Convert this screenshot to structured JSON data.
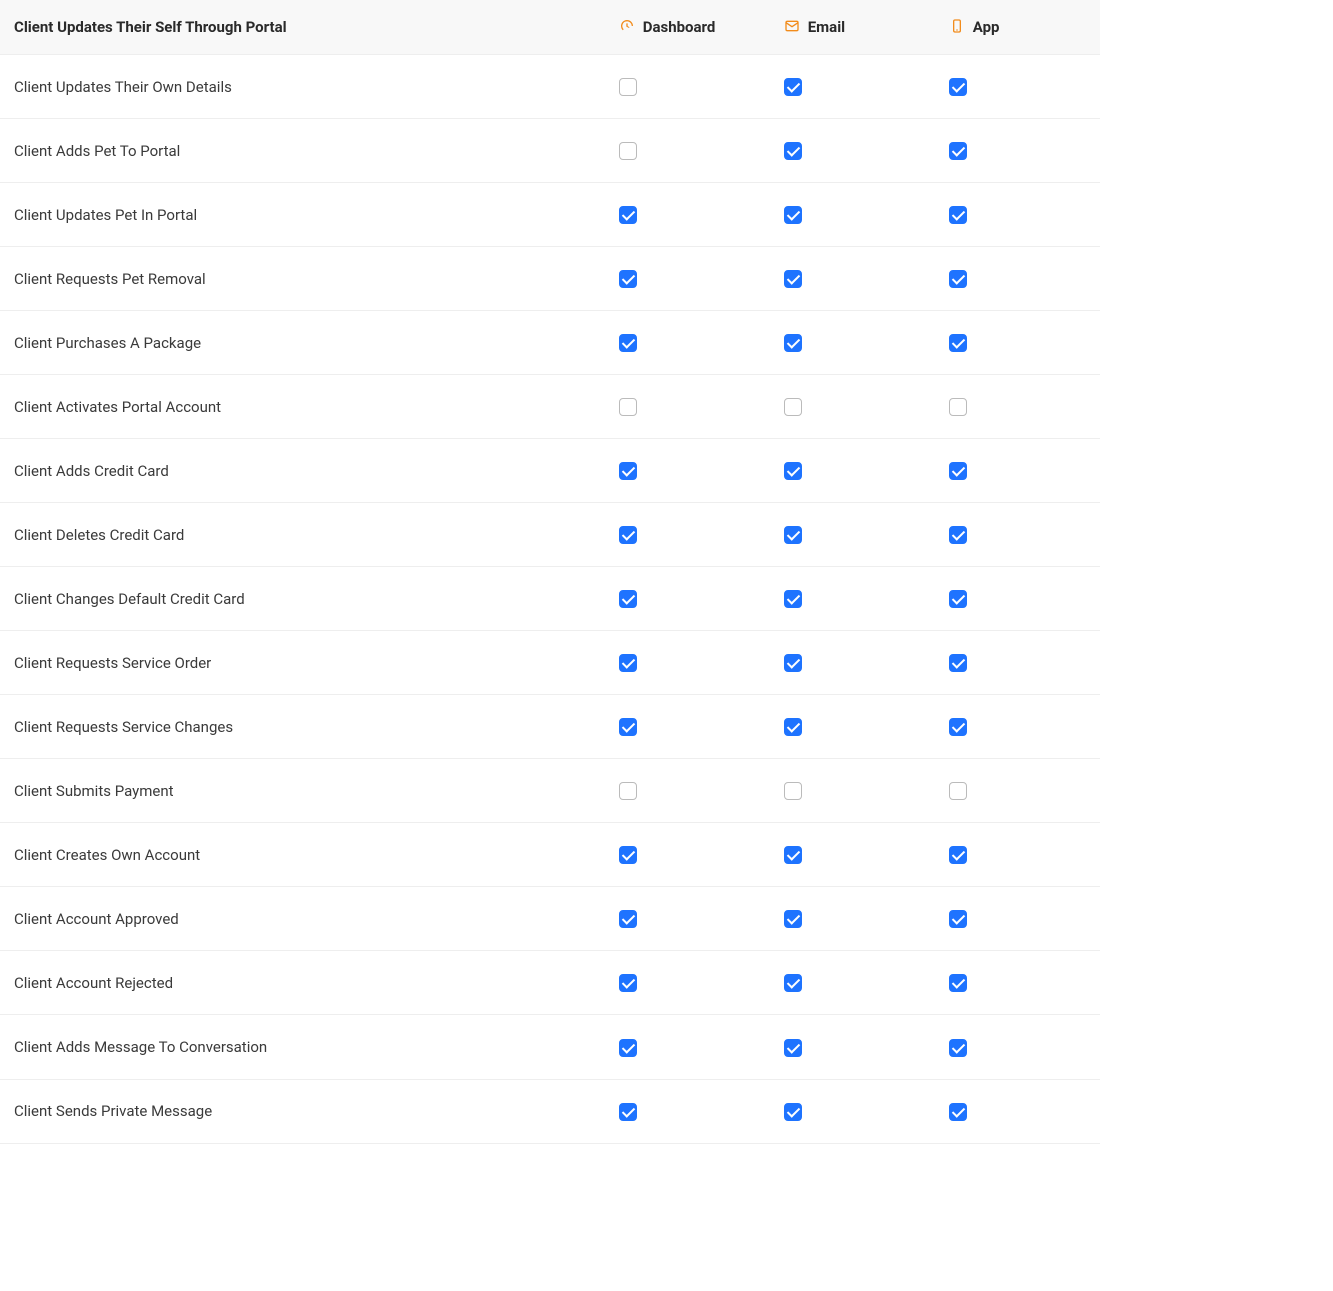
{
  "header": {
    "title": "Client Updates Their Self Through Portal",
    "columns": [
      {
        "icon": "dashboard-icon",
        "label": "Dashboard"
      },
      {
        "icon": "email-icon",
        "label": "Email"
      },
      {
        "icon": "app-icon",
        "label": "App"
      }
    ]
  },
  "icon_color": "#f28c1c",
  "rows": [
    {
      "label": "Client Updates Their Own Details",
      "dashboard": false,
      "email": true,
      "app": true
    },
    {
      "label": "Client Adds Pet To Portal",
      "dashboard": false,
      "email": true,
      "app": true
    },
    {
      "label": "Client Updates Pet In Portal",
      "dashboard": true,
      "email": true,
      "app": true
    },
    {
      "label": "Client Requests Pet Removal",
      "dashboard": true,
      "email": true,
      "app": true
    },
    {
      "label": "Client Purchases A Package",
      "dashboard": true,
      "email": true,
      "app": true
    },
    {
      "label": "Client Activates Portal Account",
      "dashboard": false,
      "email": false,
      "app": false
    },
    {
      "label": "Client Adds Credit Card",
      "dashboard": true,
      "email": true,
      "app": true
    },
    {
      "label": "Client Deletes Credit Card",
      "dashboard": true,
      "email": true,
      "app": true
    },
    {
      "label": "Client Changes Default Credit Card",
      "dashboard": true,
      "email": true,
      "app": true
    },
    {
      "label": "Client Requests Service Order",
      "dashboard": true,
      "email": true,
      "app": true
    },
    {
      "label": "Client Requests Service Changes",
      "dashboard": true,
      "email": true,
      "app": true
    },
    {
      "label": "Client Submits Payment",
      "dashboard": false,
      "email": false,
      "app": false
    },
    {
      "label": "Client Creates Own Account",
      "dashboard": true,
      "email": true,
      "app": true
    },
    {
      "label": "Client Account Approved",
      "dashboard": true,
      "email": true,
      "app": true
    },
    {
      "label": "Client Account Rejected",
      "dashboard": true,
      "email": true,
      "app": true
    },
    {
      "label": "Client Adds Message To Conversation",
      "dashboard": true,
      "email": true,
      "app": true
    },
    {
      "label": "Client Sends Private Message",
      "dashboard": true,
      "email": true,
      "app": true
    }
  ]
}
